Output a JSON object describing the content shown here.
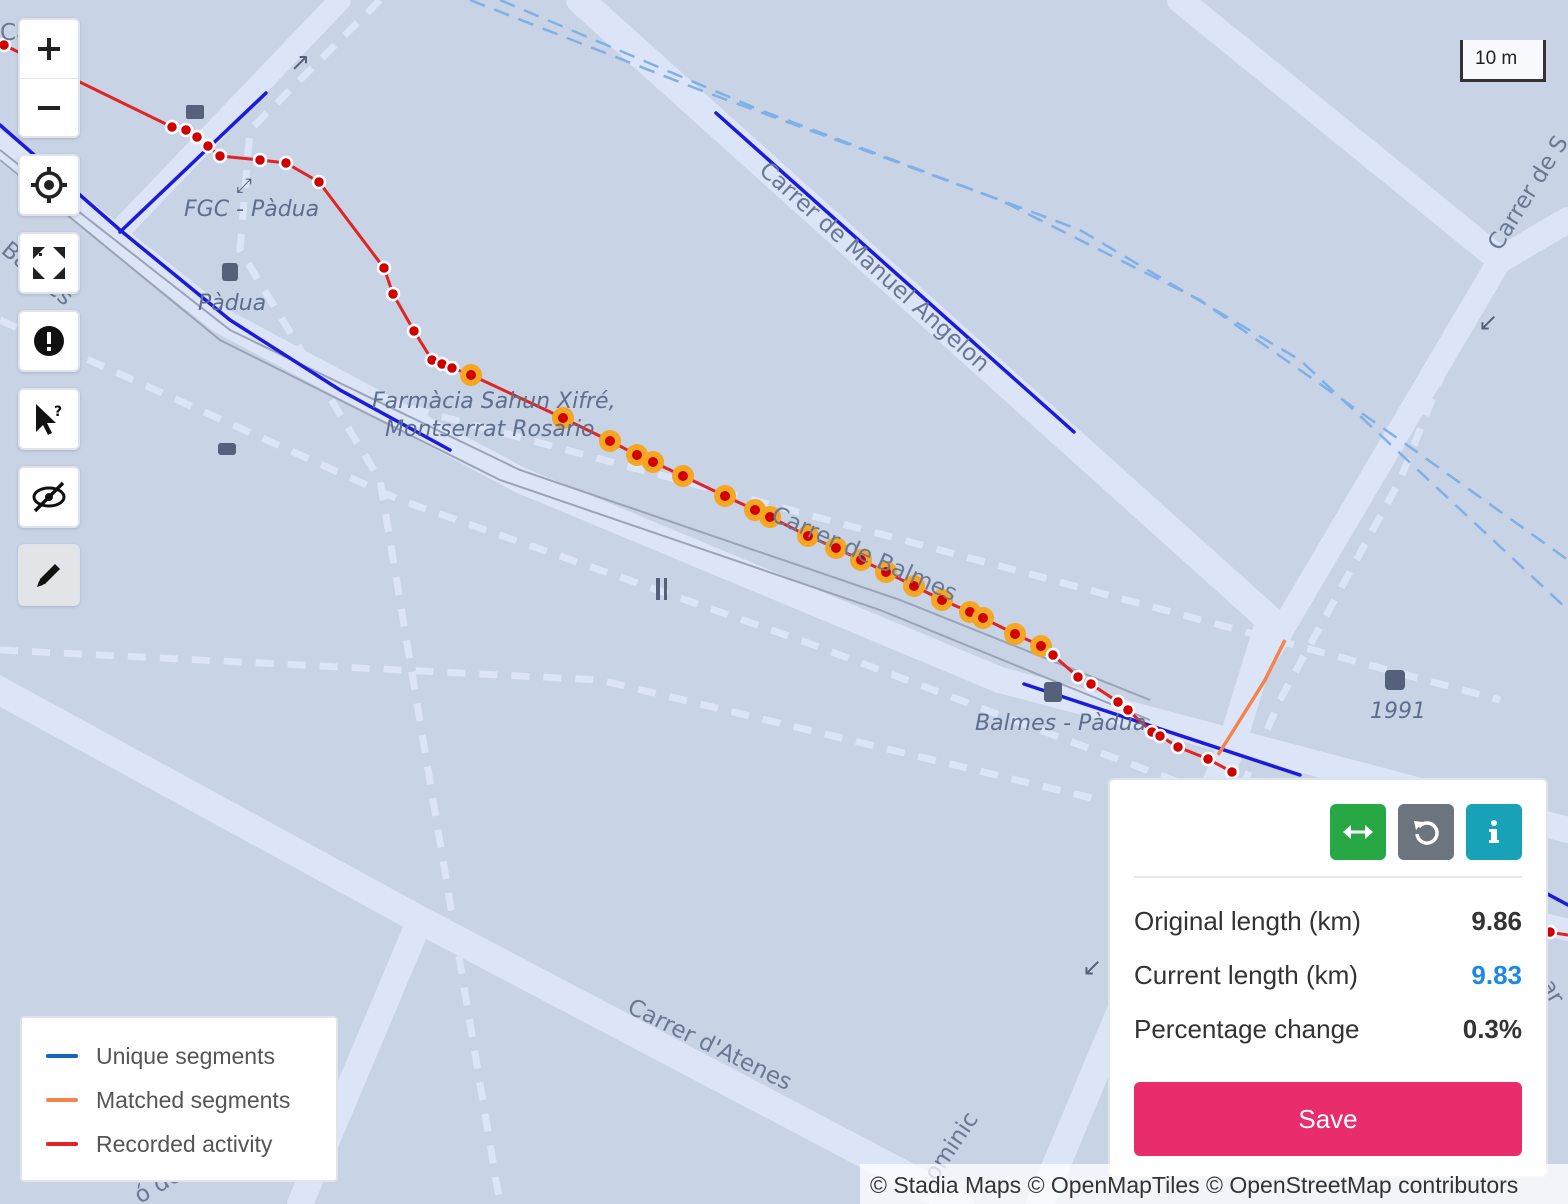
{
  "colors": {
    "map_background": "#c9d3e6",
    "road": "#dce5f7",
    "unique_segment": "#1b1bd9",
    "matched_segment": "#f4844c",
    "recorded_activity": "#e02424",
    "highlight_point": "#f5a623",
    "edit_button_green": "#28a745",
    "reset_button_gray": "#6c757d",
    "info_button_teal": "#17a2b8",
    "save_button": "#e82c6c",
    "current_length_blue": "#1e88e5"
  },
  "controls": {
    "icons": [
      "plus-icon",
      "minus-icon",
      "locate-icon",
      "fit-bounds-icon",
      "alert-icon",
      "select-help-icon",
      "hide-icon",
      "pencil-icon"
    ]
  },
  "scale": {
    "label": "10 m"
  },
  "map_labels": {
    "fgc_padua": "FGC - Pàdua",
    "padua": "Pàdua",
    "pharmacy_line1": "Farmàcia Sahun Xifré,",
    "pharmacy_line2": "Montserrat Rosario",
    "carrer_balmes": "Carrer de Balmes",
    "carrer_manuel_angelon": "Carrer de Manuel Angelon",
    "carrer_d_atenes": "Carrer d'Atenes",
    "balmes_padua": "Balmes - Pàdua",
    "label_1991": "1991",
    "carrer_de_s": "Carrer de S",
    "balmes_partial": "Balmes",
    "carrer_partial": "Carr",
    "right_partial": "ar",
    "bottom_partial": "ó de",
    "bottom_partial2": "ominic"
  },
  "legend": {
    "items": [
      {
        "label": "Unique segments",
        "color": "#1565c0"
      },
      {
        "label": "Matched segments",
        "color": "#f4844c"
      },
      {
        "label": "Recorded activity",
        "color": "#e02424"
      }
    ]
  },
  "panel": {
    "actions": [
      "split-icon",
      "reset-icon",
      "info-icon"
    ],
    "stats": [
      {
        "label": "Original length (km)",
        "value": "9.86",
        "color": "#333333"
      },
      {
        "label": "Current length (km)",
        "value": "9.83",
        "color": "#1e88e5"
      },
      {
        "label": "Percentage change",
        "value": "0.3%",
        "color": "#333333"
      }
    ],
    "save_label": "Save"
  },
  "attribution": "© Stadia Maps © OpenMapTiles © OpenStreetMap contributors"
}
